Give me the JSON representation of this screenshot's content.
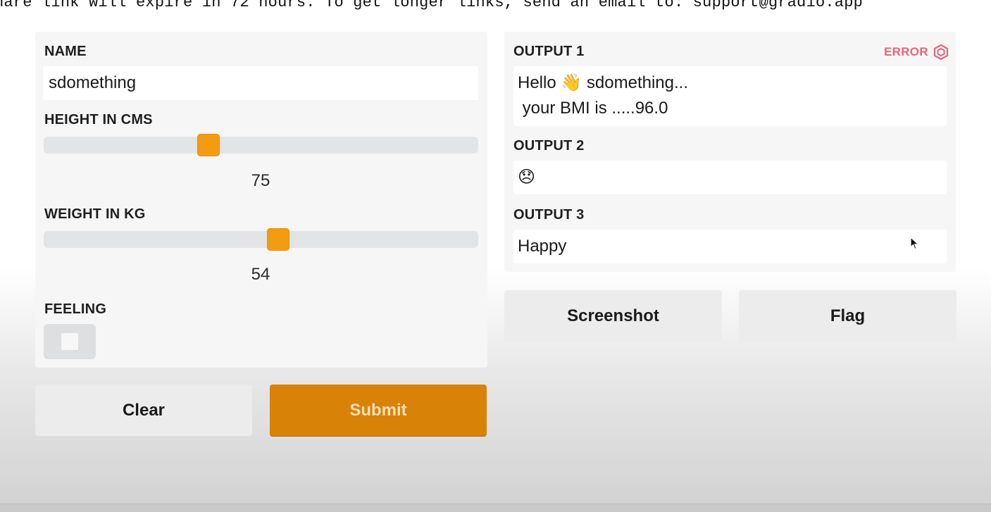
{
  "banner": {
    "text": "hare link will expire in 72 hours. To get longer links, send an email to: support@gradio.app"
  },
  "inputs": {
    "name": {
      "label": "NAME",
      "value": "sdomething"
    },
    "height": {
      "label": "HEIGHT IN CMS",
      "value": "75",
      "fraction": 0.38
    },
    "weight": {
      "label": "WEIGHT IN KG",
      "value": "54",
      "fraction": 0.54
    },
    "feeling": {
      "label": "FEELING",
      "checked": false
    }
  },
  "buttons": {
    "clear": "Clear",
    "submit": "Submit",
    "screenshot": "Screenshot",
    "flag": "Flag"
  },
  "outputs": {
    "error_badge": "ERROR",
    "output1": {
      "label": "OUTPUT 1",
      "value": "Hello 👋 sdomething...\n your BMI is .....96.0"
    },
    "output2": {
      "label": "OUTPUT 2",
      "value": "😞"
    },
    "output3": {
      "label": "OUTPUT 3",
      "value": "Happy"
    }
  },
  "colors": {
    "accent": "#f39c12",
    "submit": "#d98208",
    "error": "#e7657a"
  },
  "icons": [
    "error-hexagon-icon",
    "mouse-pointer-icon"
  ]
}
